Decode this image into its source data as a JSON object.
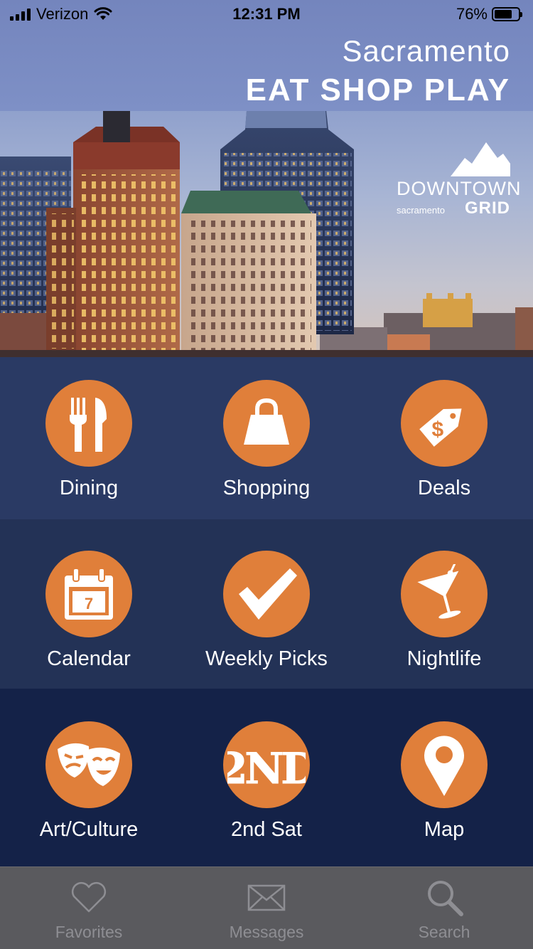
{
  "status": {
    "carrier": "Verizon",
    "time": "12:31 PM",
    "battery": "76%",
    "battery_level": 0.76
  },
  "hero": {
    "city": "Sacramento",
    "tagline": "EAT SHOP PLAY",
    "logo": {
      "line1": "DOWNTOWN",
      "line2": "sacramento",
      "line3": "GRID"
    }
  },
  "menu": [
    {
      "label": "Dining",
      "icon": "fork-knife-icon"
    },
    {
      "label": "Shopping",
      "icon": "shopping-bag-icon"
    },
    {
      "label": "Deals",
      "icon": "price-tag-icon"
    },
    {
      "label": "Calendar",
      "icon": "calendar-icon",
      "icon_text": "7"
    },
    {
      "label": "Weekly Picks",
      "icon": "checkmark-icon"
    },
    {
      "label": "Nightlife",
      "icon": "martini-icon"
    },
    {
      "label": "Art/Culture",
      "icon": "theater-masks-icon"
    },
    {
      "label": "2nd Sat",
      "icon": "2nd-icon",
      "icon_text": "2ND"
    },
    {
      "label": "Map",
      "icon": "map-pin-icon"
    }
  ],
  "tabs": [
    {
      "label": "Favorites",
      "icon": "heart-icon"
    },
    {
      "label": "Messages",
      "icon": "envelope-icon"
    },
    {
      "label": "Search",
      "icon": "search-icon"
    }
  ],
  "colors": {
    "accent": "#e07f3a",
    "row1": "#2a3a64",
    "row2": "#233256",
    "row3": "#142248",
    "tabbar": "#5a5a5e"
  }
}
